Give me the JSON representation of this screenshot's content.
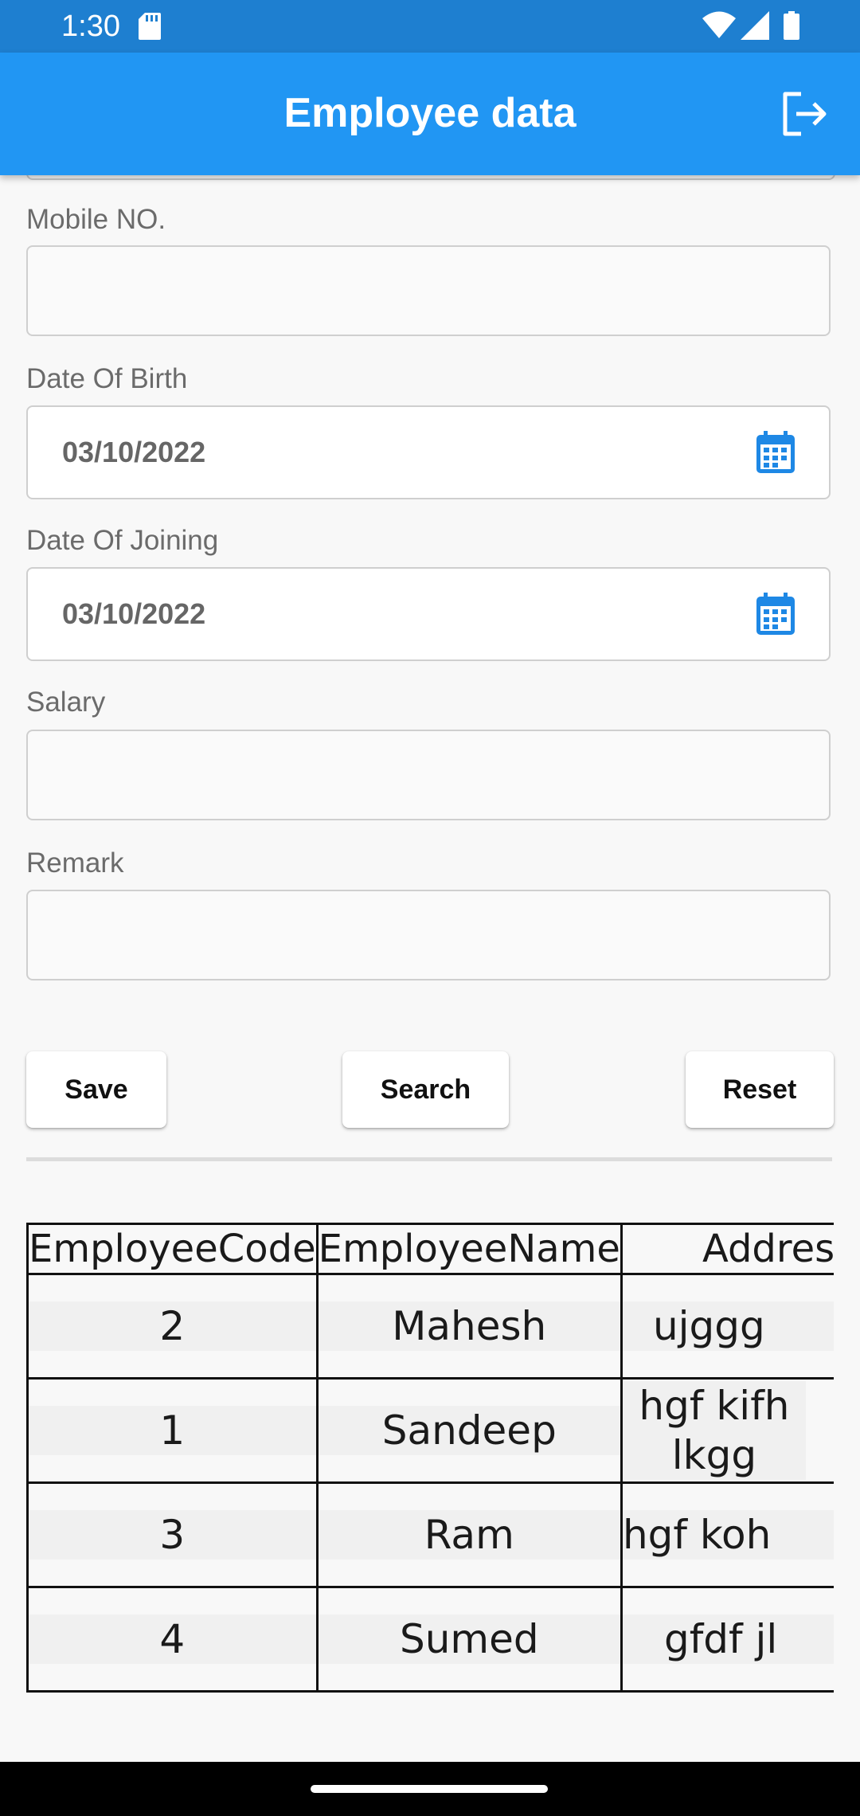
{
  "status_bar": {
    "time": "1:30"
  },
  "app_bar": {
    "title": "Employee data"
  },
  "form": {
    "mobile_label": "Mobile NO.",
    "mobile_value": "",
    "dob_label": "Date Of Birth",
    "dob_value": "03/10/2022",
    "doj_label": "Date Of Joining",
    "doj_value": "03/10/2022",
    "salary_label": "Salary",
    "salary_value": "",
    "remark_label": "Remark",
    "remark_value": ""
  },
  "buttons": {
    "save": "Save",
    "search": "Search",
    "reset": "Reset"
  },
  "table": {
    "headers": [
      "EmployeeCode",
      "EmployeeName",
      "Address"
    ],
    "rows": [
      {
        "code": "2",
        "name": "Mahesh",
        "address": "ujggg"
      },
      {
        "code": "1",
        "name": "Sandeep",
        "address": "hgf kifh lkgg"
      },
      {
        "code": "3",
        "name": "Ram",
        "address": "hgf koh"
      },
      {
        "code": "4",
        "name": "Sumed",
        "address": "gfdf jl"
      }
    ]
  },
  "colors": {
    "status_bar": "#1e7fd0",
    "app_bar": "#2196f3",
    "accent_icon": "#1e88e5"
  },
  "icons": {
    "logout": "logout-icon",
    "calendar": "calendar-icon"
  }
}
